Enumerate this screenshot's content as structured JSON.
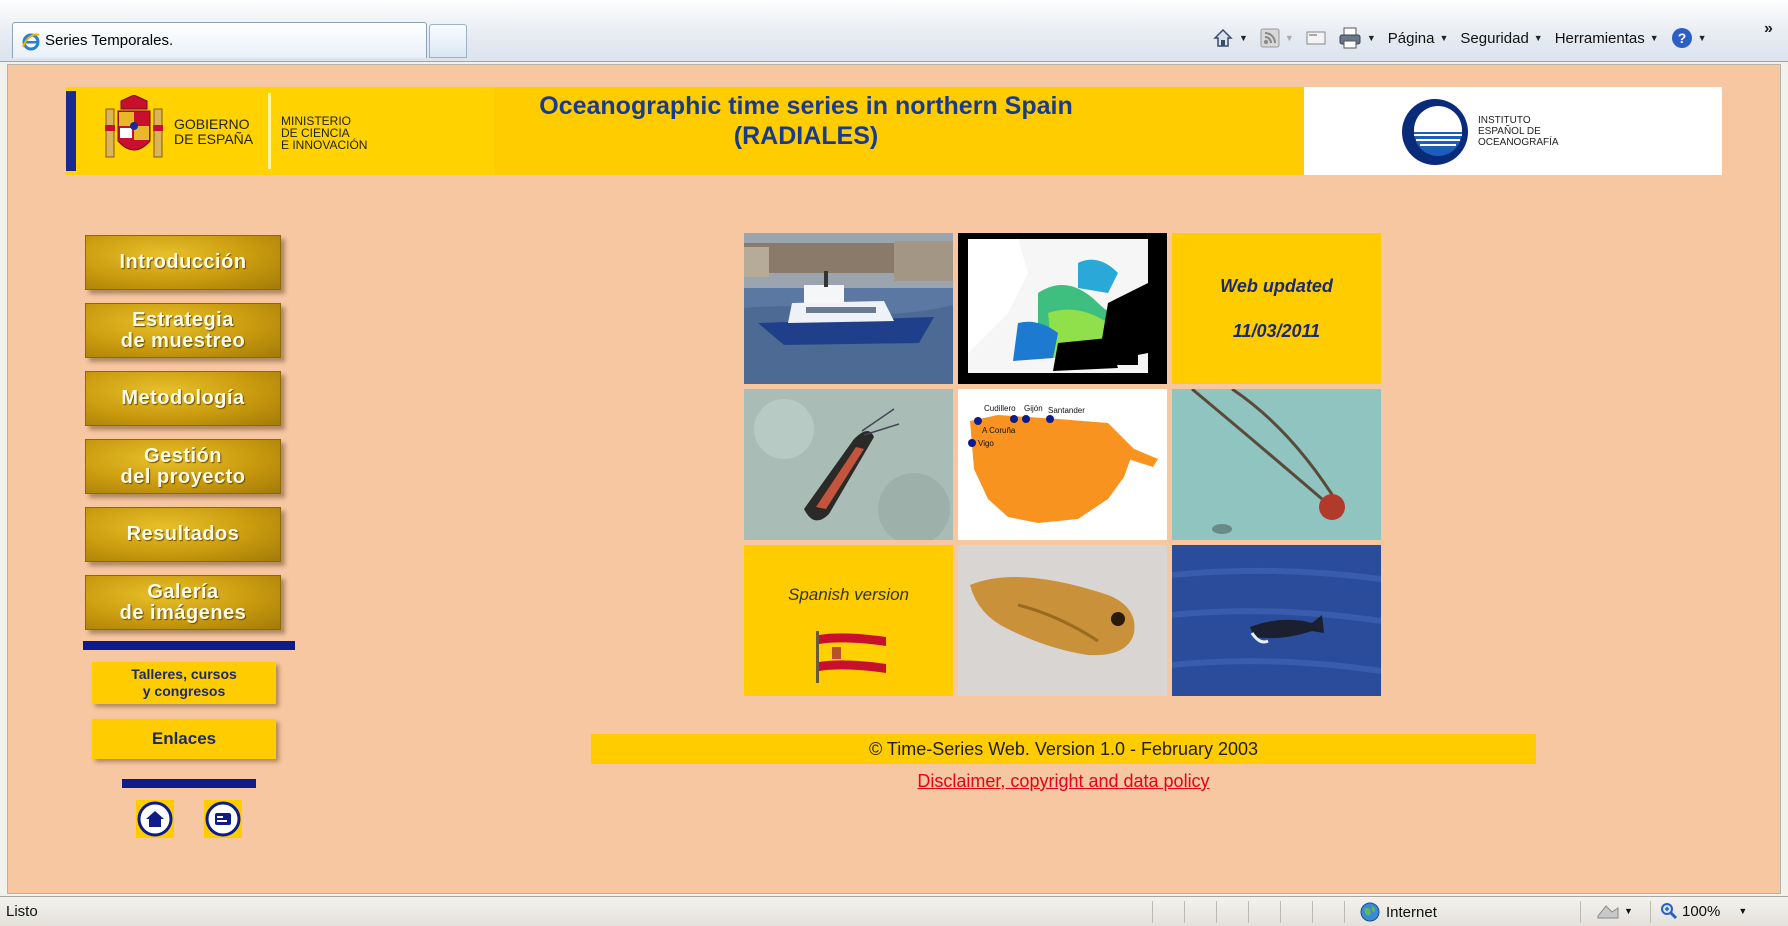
{
  "browser": {
    "tab_title": "Series Temporales.",
    "commands": {
      "page": "Página",
      "security": "Seguridad",
      "tools": "Herramientas"
    },
    "status_text": "Listo",
    "zone": "Internet",
    "zoom": "100%"
  },
  "header": {
    "gob_line1": "GOBIERNO",
    "gob_line2": "DE ESPAÑA",
    "ministry_line1": "MINISTERIO",
    "ministry_line2": "DE CIENCIA",
    "ministry_line3": "E INNOVACIÓN",
    "title_line1": "Oceanographic time series in northern Spain",
    "title_line2": "(RADIALES)",
    "ieo_line1": "INSTITUTO",
    "ieo_line2": "ESPAÑOL DE",
    "ieo_line3": "OCEANOGRAFÍA"
  },
  "nav": {
    "items": [
      {
        "line1": "Introducción",
        "line2": ""
      },
      {
        "line1": "Estrategia",
        "line2": "de muestreo"
      },
      {
        "line1": "Metodología",
        "line2": ""
      },
      {
        "line1": "Gestión",
        "line2": "del proyecto"
      },
      {
        "line1": "Resultados",
        "line2": ""
      },
      {
        "line1": "Galería",
        "line2": "de imágenes"
      }
    ],
    "workshops_line1": "Talleres, cursos",
    "workshops_line2": "y congresos",
    "links": "Enlaces"
  },
  "grid": {
    "updated_label": "Web updated",
    "updated_date": "11/03/2011",
    "spanish_label": "Spanish version",
    "map_labels": [
      "Cudillero",
      "Gijón",
      "Santander",
      "A Coruña",
      "Vigo"
    ]
  },
  "footer": {
    "copyright": "© Time-Series Web. Version 1.0 - February 2003",
    "disclaimer": "Disclaimer, copyright and data policy"
  },
  "colors": {
    "page_bg": "#f7c7a2",
    "yellow": "#ffcc00",
    "title_blue": "#1a3a8c",
    "nav_gold": "#c99a0e",
    "link_red": "#e8001c"
  }
}
